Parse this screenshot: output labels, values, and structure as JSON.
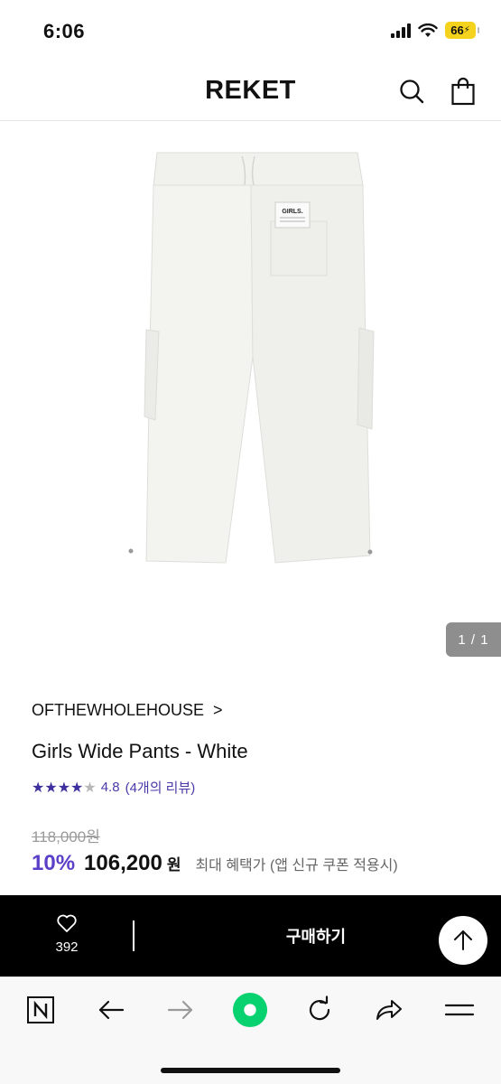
{
  "status_bar": {
    "time": "6:06",
    "battery": "66"
  },
  "header": {
    "brand": "REKET",
    "search_icon": "search-icon",
    "bag_icon": "shopping-bag-icon"
  },
  "gallery": {
    "pager": "1 / 1",
    "label_text": "GIRLS."
  },
  "product": {
    "brand": "OFTHEWHOLEHOUSE",
    "brand_chevron": ">",
    "title": "Girls Wide Pants - White",
    "rating": 4.8,
    "rating_text": "4.8",
    "review_text": "(4개의 리뷰)",
    "original_price": "118,000원",
    "discount": "10%",
    "sale_price": "106,200",
    "currency": "원",
    "benefit_note": "최대 혜택가 (앱 신규 쿠폰 적용시)"
  },
  "purchase_bar": {
    "like_count": "392",
    "buy_label": "구매하기",
    "heart_icon": "heart-icon",
    "top_icon": "arrow-up-icon"
  },
  "browser": {
    "buttons": [
      "naver-icon",
      "back-arrow-icon",
      "forward-arrow-icon",
      "home-green-icon",
      "reload-icon",
      "share-icon",
      "menu-icon"
    ]
  },
  "colors": {
    "accent": "#5b3fc8",
    "rating": "#3d2f9e",
    "buy_bar": "#000000",
    "home_green": "#08d26f",
    "battery": "#f5d21b"
  }
}
